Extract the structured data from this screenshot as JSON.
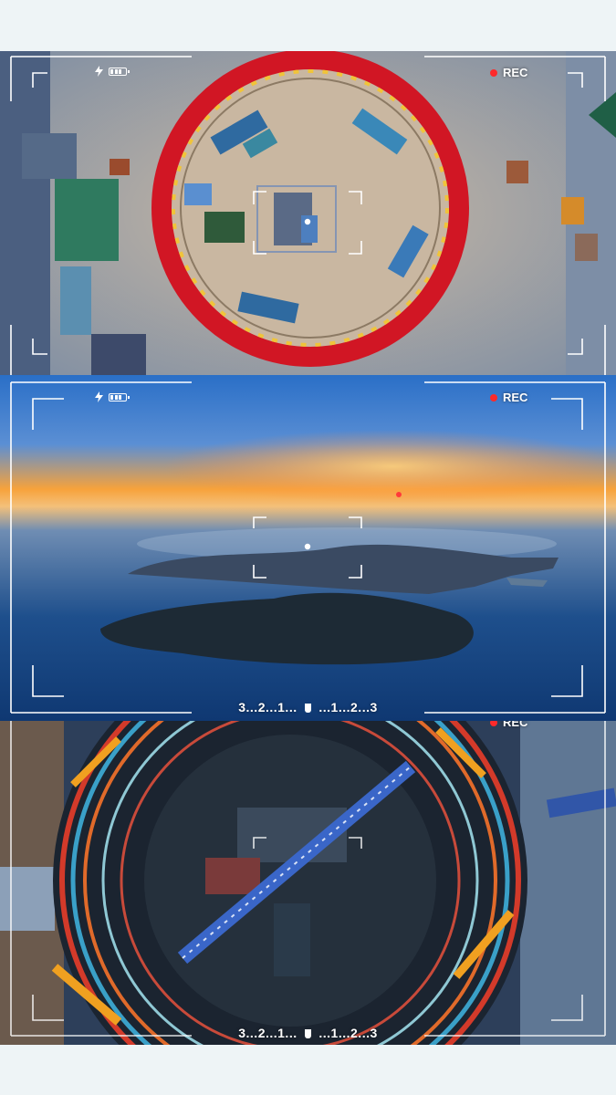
{
  "panels": [
    {
      "id": "construction-site",
      "rec_label": "REC",
      "flash_icon": "lightning-icon",
      "battery_icon": "battery-icon",
      "countdown": ""
    },
    {
      "id": "island-sunset",
      "rec_label": "REC",
      "flash_icon": "lightning-icon",
      "battery_icon": "battery-icon",
      "countdown_left": "3...2...1...",
      "countdown_right": "...1...2...3"
    },
    {
      "id": "reactor-dome",
      "rec_label": "REC",
      "countdown_left": "3...2...1...",
      "countdown_right": "...1...2...3"
    }
  ],
  "colors": {
    "rec_dot": "#ff2a2a",
    "frame": "#ffffff",
    "ring_red": "#d11624",
    "sky_orange": "#f7a23b"
  }
}
